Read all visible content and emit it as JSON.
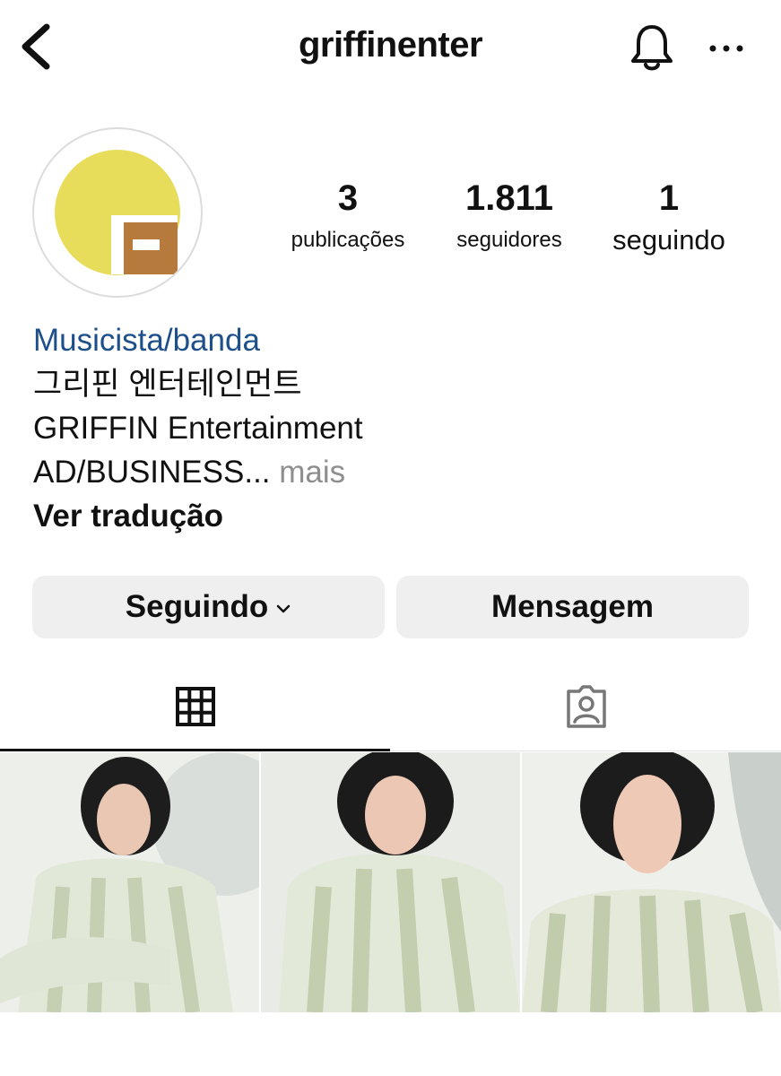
{
  "header": {
    "username": "griffinenter",
    "back_icon": "chevron-left-icon",
    "bell_icon": "bell-icon",
    "more_icon": "more-horizontal-icon"
  },
  "profile": {
    "avatar_colors": {
      "circle": "#e8dd5b",
      "block": "#b57a3c"
    },
    "stats": [
      {
        "value": "3",
        "label": "publicações"
      },
      {
        "value": "1.811",
        "label": "seguidores"
      },
      {
        "value": "1",
        "label": "seguindo"
      }
    ],
    "category": "Musicista/banda",
    "bio_lines": [
      "그리핀 엔터테인먼트",
      "GRIFFIN Entertainment"
    ],
    "bio_truncated": "AD/BUSINESS...",
    "more_label": "mais",
    "translate_label": "Ver tradução"
  },
  "actions": {
    "following_label": "Seguindo",
    "message_label": "Mensagem"
  },
  "tabs": {
    "grid_icon": "grid-icon",
    "tagged_icon": "tagged-person-icon",
    "active": "grid"
  },
  "posts": [
    {
      "icon": "photo-thumbnail"
    },
    {
      "icon": "photo-thumbnail"
    },
    {
      "icon": "photo-thumbnail"
    }
  ]
}
